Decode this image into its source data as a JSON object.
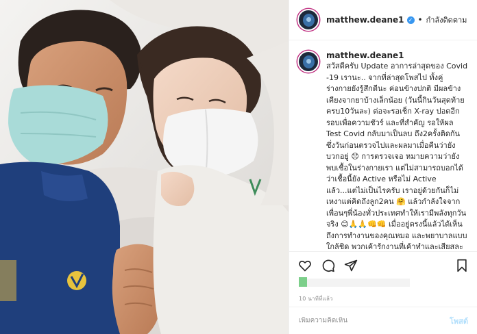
{
  "post": {
    "photo_description_icon": "selfie-photo"
  },
  "header": {
    "username": "matthew.deane1",
    "verified_icon": "verified-badge-icon",
    "separator": "•",
    "follow_status": "กำลังติดตาม"
  },
  "caption": {
    "username": "matthew.deane1",
    "text": "สวัสดีครับ Update อาการล่าสุดของ Covid -19 เรานะ.. จากที่ล่าสุดโพสไป ทั้งคู่ร่างกายยังรู้สึกดีนะ ค่อนข้างปกติ มีผลข้างเคียงจากยาบ้างเล็กน้อย (วันนี้กินวันสุดท้าย ครบ10วันละ) ต่อจะรอเช็ก X-ray ปอดอีกรอบเพื่อความชัวร์ และที่สำคัญ รอให้ผล Test Covid กลับมาเป็นลบ ถึง2ครั้งติดกัน ซึ่งวันก่อนตรวจไปและผลมาเมื่อคืนว่ายังบวกอยู่ 😞 การตรวจเจอ หมายความว่ายังพบเชื้อในร่างกายเรา แต่ไม่สามารถบอกได้ว่าเชื้อนี้ยัง Active หรือไม่ Active แล้ว...แต่ไม่เป็นไรครับ เราอยู่ด้วยกันก็ไม่เหงาแต่คิดถึงลูก2คน 🤗 แล้วกำลังใจจากเพื่อนๆพี่น้องทั่วประเทศทำให้เรามีพลังทุกวันจริง 😊🙏🙏👊👊 เมื่ออยู่ตรงนี้แล้วได้เห็นถึงการทำงานของคุณหมอ และพยาบาลแบบใกล้ชิด พวกเค้ารักงานที่เค้าทำและเสียสละหลายอย่าง เพื่อดูแลรักษา"
  },
  "actions": {
    "like_icon": "heart-icon",
    "comment_icon": "comment-icon",
    "share_icon": "share-icon",
    "save_icon": "bookmark-icon"
  },
  "meta": {
    "time_ago": "10 นาทีที่แล้ว"
  },
  "comment_box": {
    "placeholder": "เพิ่มความคิดเห็น",
    "post_label": "โพสต์"
  }
}
